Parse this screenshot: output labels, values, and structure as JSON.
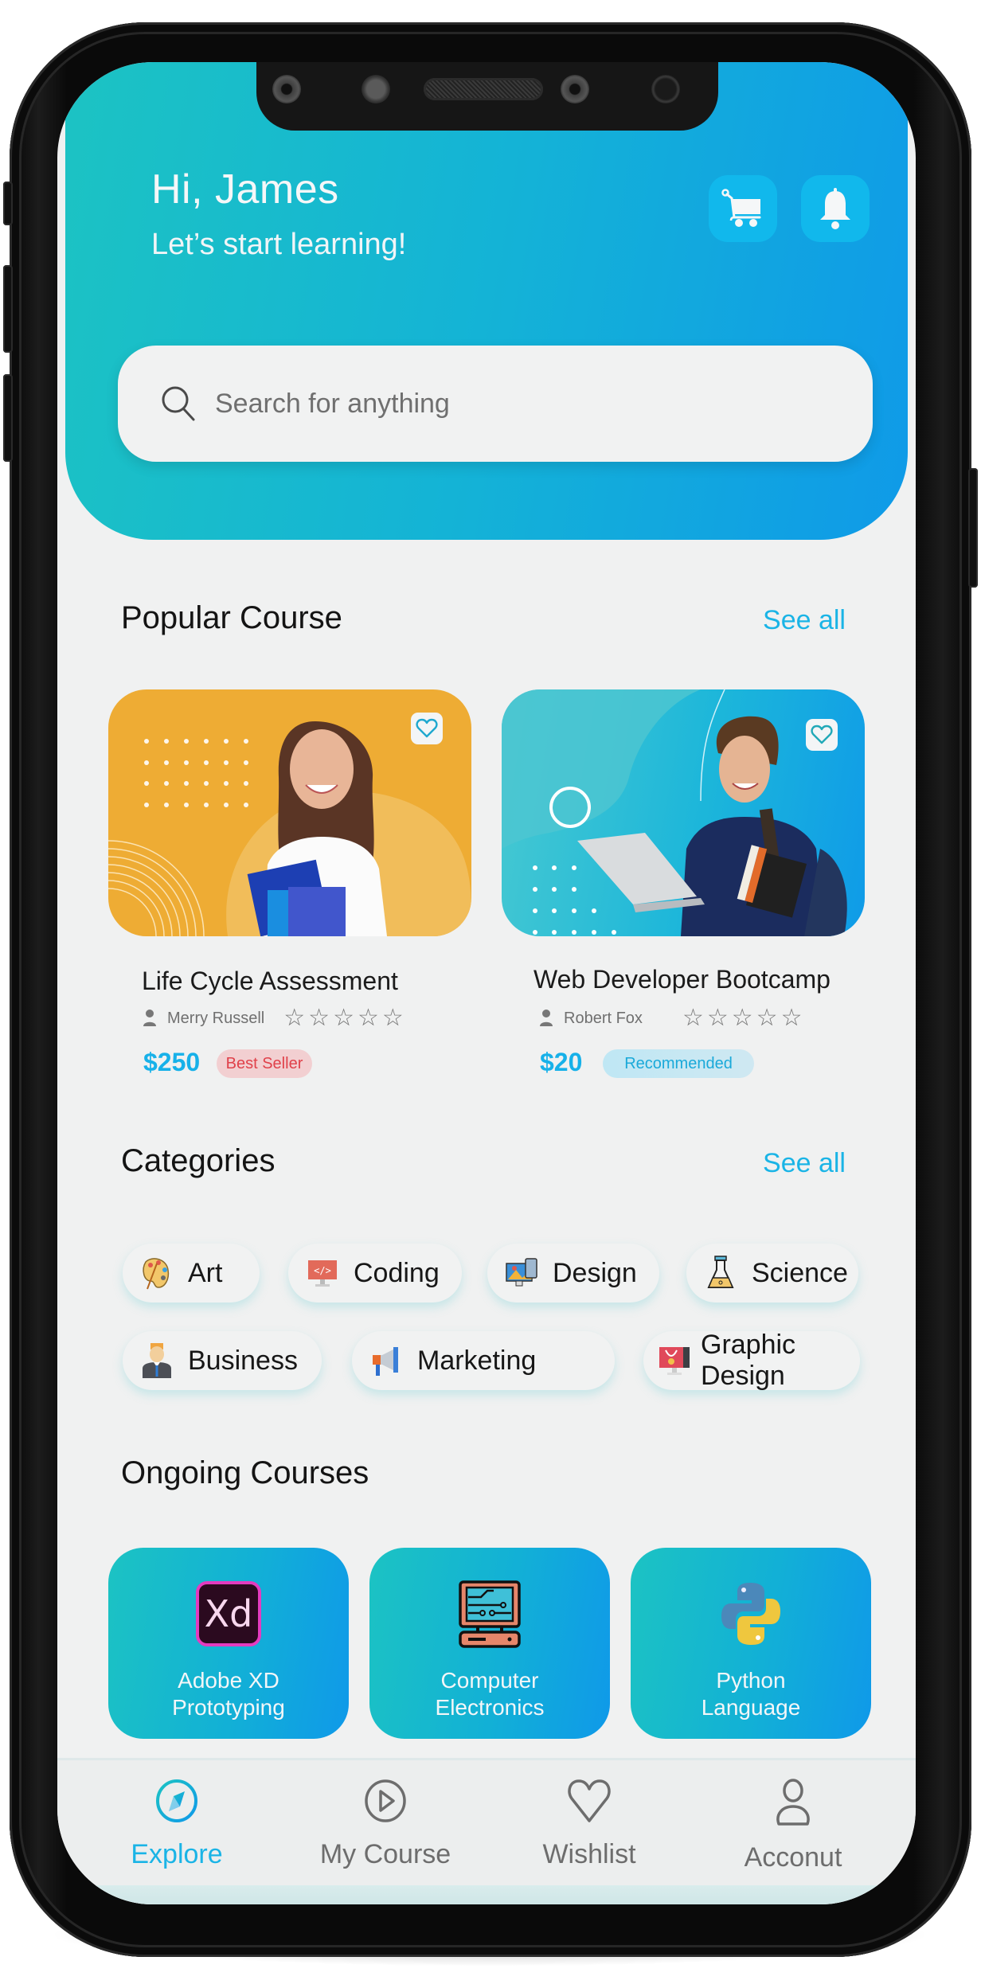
{
  "header": {
    "greeting": "Hi, James",
    "subtitle": "Let’s start learning!",
    "cart_icon": "cart-icon",
    "notification_icon": "bell-icon"
  },
  "search": {
    "placeholder": "Search for anything",
    "value": "",
    "icon": "search-icon"
  },
  "popular": {
    "title": "Popular Course",
    "see_all": "See all",
    "courses": [
      {
        "title": "Life Cycle Assessment",
        "instructor": "Merry Russell",
        "rating": 0,
        "rating_max": 5,
        "price": "$250",
        "badge": "Best Seller",
        "wishlisted": false
      },
      {
        "title": "Web Developer Bootcamp",
        "instructor": "Robert Fox",
        "rating": 0,
        "rating_max": 5,
        "price": "$20",
        "badge": "Recommended",
        "wishlisted": false
      }
    ]
  },
  "categories": {
    "title": "Categories",
    "see_all": "See all",
    "items": [
      {
        "label": "Art",
        "icon": "palette-icon"
      },
      {
        "label": "Coding",
        "icon": "code-monitor-icon"
      },
      {
        "label": "Design",
        "icon": "design-devices-icon"
      },
      {
        "label": "Science",
        "icon": "flask-icon"
      },
      {
        "label": "Business",
        "icon": "businessman-icon"
      },
      {
        "label": "Marketing",
        "icon": "megaphone-icon"
      },
      {
        "label": "Graphic Design",
        "icon": "pen-tool-monitor-icon"
      }
    ]
  },
  "ongoing": {
    "title": "Ongoing Courses",
    "items": [
      {
        "line1": "Adobe XD",
        "line2": "Prototyping",
        "icon": "adobe-xd-icon",
        "icon_text": "Xd"
      },
      {
        "line1": "Computer",
        "line2": "Electronics",
        "icon": "circuit-computer-icon"
      },
      {
        "line1": "Python",
        "line2": "Language",
        "icon": "python-icon"
      }
    ]
  },
  "bottom_nav": {
    "active": "Explore",
    "items": [
      {
        "label": "Explore",
        "icon": "compass-icon"
      },
      {
        "label": "My Course",
        "icon": "play-circle-icon"
      },
      {
        "label": "Wishlist",
        "icon": "heart-icon"
      },
      {
        "label": "Acconut",
        "icon": "user-icon"
      }
    ]
  },
  "colors": {
    "accent": "#1AB4E6",
    "hero_gradient_start": "#1CC3C3",
    "hero_gradient_end": "#0F9AE8",
    "badge_red_text": "#E0414A",
    "badge_red_bg": "#F2CFD1",
    "course_orange": "#EEAC34",
    "background": "#F0F1F1"
  }
}
